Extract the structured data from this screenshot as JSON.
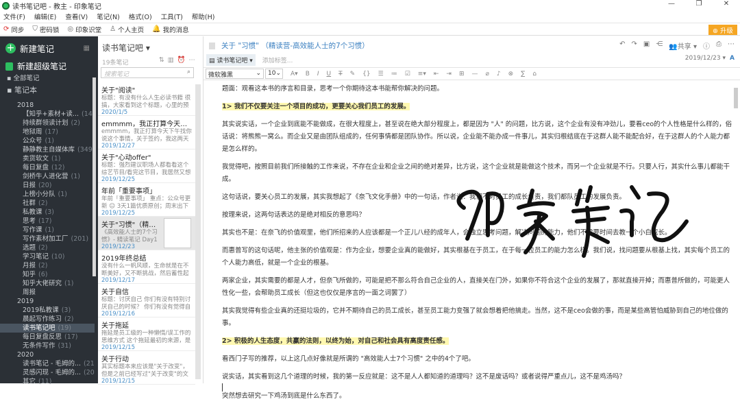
{
  "window": {
    "title": "读书笔记吧 - 教主 - 印象笔记",
    "controls": [
      "—",
      "❐",
      "✕"
    ]
  },
  "menu": [
    "文件(F)",
    "编辑(E)",
    "查看(V)",
    "笔记(N)",
    "格式(O)",
    "工具(T)",
    "帮助(H)"
  ],
  "toolbar": {
    "items": [
      {
        "icon": "sync-icon",
        "glyph": "⟳",
        "label": "同步"
      },
      {
        "icon": "shield-icon",
        "glyph": "⛉",
        "label": "密码锁"
      },
      {
        "icon": "record-icon",
        "glyph": "◎",
        "label": "印象识堂"
      },
      {
        "icon": "user-icon",
        "glyph": "♙",
        "label": "个人主页"
      },
      {
        "icon": "bell-icon",
        "glyph": "🔔",
        "label": "我的消息"
      }
    ],
    "upgrade": "升级"
  },
  "sidebar": {
    "new_note": "新建笔记",
    "new_super_note": "新建超级笔记",
    "all_notes": "全部笔记",
    "notebooks": "笔记本",
    "items": [
      {
        "label": "2018",
        "count": "",
        "level": 0
      },
      {
        "label": "【知乎+素材+读...",
        "count": "(14)",
        "level": 1
      },
      {
        "label": "持续群领读计划",
        "count": "(2)",
        "level": 1
      },
      {
        "label": "地狱周",
        "count": "(17)",
        "level": 1
      },
      {
        "label": "公众号",
        "count": "(1)",
        "level": 1
      },
      {
        "label": "静静教主自媒体库",
        "count": "(349)",
        "level": 1
      },
      {
        "label": "卖货软文",
        "count": "(1)",
        "level": 1
      },
      {
        "label": "每日复盘",
        "count": "(12)",
        "level": 1
      },
      {
        "label": "剑桥牛人进化营",
        "count": "(1)",
        "level": 1
      },
      {
        "label": "日报",
        "count": "(20)",
        "level": 1
      },
      {
        "label": "上榜小分队",
        "count": "(1)",
        "level": 1
      },
      {
        "label": "社群",
        "count": "(2)",
        "level": 1
      },
      {
        "label": "私教课",
        "count": "(3)",
        "level": 1
      },
      {
        "label": "思考",
        "count": "(17)",
        "level": 1
      },
      {
        "label": "写作课",
        "count": "(1)",
        "level": 1
      },
      {
        "label": "写作素材加工厂",
        "count": "(201)",
        "level": 1
      },
      {
        "label": "选题",
        "count": "(2)",
        "level": 1
      },
      {
        "label": "学习笔记",
        "count": "(10)",
        "level": 1
      },
      {
        "label": "月报",
        "count": "(2)",
        "level": 1
      },
      {
        "label": "知乎",
        "count": "(6)",
        "level": 1
      },
      {
        "label": "知乎大佬研究",
        "count": "(1)",
        "level": 1
      },
      {
        "label": "周报",
        "count": "",
        "level": 1
      },
      {
        "label": "2019",
        "count": "",
        "level": 0
      },
      {
        "label": "2019私教课",
        "count": "(3)",
        "level": 1
      },
      {
        "label": "晨起写作练习",
        "count": "(2)",
        "level": 1
      },
      {
        "label": "读书笔记吧",
        "count": "(19)",
        "level": 1,
        "selected": true
      },
      {
        "label": "每日复盘反思",
        "count": "(17)",
        "level": 1
      },
      {
        "label": "无条件写作",
        "count": "(31)",
        "level": 1
      },
      {
        "label": "2020",
        "count": "",
        "level": 0
      },
      {
        "label": "读书笔记 - 毛姆的...",
        "count": "(21)",
        "level": 1
      },
      {
        "label": "灵感闪现 - 毛姆的...",
        "count": "(20)",
        "level": 1
      },
      {
        "label": "其它",
        "count": "(11)",
        "level": 1
      }
    ]
  },
  "notelist": {
    "title": "读书笔记吧 ▾",
    "count": "19条笔记",
    "search_placeholder": "搜索笔记",
    "notes": [
      {
        "title": "关于\"阅读\"",
        "snippet": "标题：有没有什么人生必读书籍 很搞，大家看到这个标题，心里的预期一定...",
        "date": "2020/1/5"
      },
      {
        "title": "emmmm，我正打算今天下午找...",
        "snippet": "emmmm，我正打算今天下午找你说这个事情，关于签约，我这两天自己也...",
        "date": "2019/12/27"
      },
      {
        "title": "关于\"心动offer\"",
        "snippet": "标题：强烈建议职场人都看看这个综艺节目/看完这节目，我居然又想去上班...",
        "date": "2019/12/25"
      },
      {
        "title": "年前「重要事项」",
        "snippet": "年前「重要事项」 重点：公众号更新 ☺ 3天1篇优质原创；周末出下周选...",
        "date": "2019/12/25"
      },
      {
        "title": "关于\"习惯\"（精读营...",
        "snippet": "《高效能人士的7个习惯》- 精读笔记 Day1 ...",
        "date": "2019/12/23",
        "selected": true
      },
      {
        "title": "2019年终总结",
        "snippet": "没有什么一帆风顺，生命就是在不断美好，又不断挑战，然后蓄性起来的慵...",
        "date": "2019/12/17"
      },
      {
        "title": "关于自信",
        "snippet": "标题：讨厌自己 你们有没有特别讨厌自己的时候？ 你们有没有觉得自己特别...",
        "date": "2019/12/16"
      },
      {
        "title": "关于拖延",
        "snippet": "拖延是员工级的一种懒惰/误工作的思维方式 这个拖延最初的来源，是之前在...",
        "date": "2019/12/15"
      },
      {
        "title": "关于行动",
        "snippet": "其实标题本来应该是\"关于改变\"，但是之前已经写过\"关于改变\"的文章了。那...",
        "date": "2019/12/15"
      }
    ]
  },
  "editor": {
    "title": "关于 \"习惯\" （精读营-高效能人士的7个习惯）",
    "notebook": "读书笔记吧 ▾",
    "tag_placeholder": "添加标签...",
    "share": "共享 ▾",
    "date": "2019/12/23 ▾",
    "font": "微软雅黑",
    "size": "10",
    "paragraphs": [
      {
        "text": "题面：观看这本书的序言和目录，思考一个你期待这本书能帮你解决的问题。"
      },
      {
        "text": "1> 我们不仅要关注一个项目的成功，更要关心我们员工的发展。",
        "highlight": true
      },
      {
        "text": "其实说实话，一个企业到底能不能做成，在很大程度上，甚至说在绝大部分程度上，都是因为 \"人\" 的问题，比方说，这个企业有没有冲劲儿，要看ceo的个人性格是什么样的，俗话说：将熊熊一窝么。而企业又是由团队组成的，任何事情都是团队协作。所以说，企业能不能办成一件事儿，其实归根结底在于这群人能不能配合好，在于这群人的个人能力都是怎么样的。"
      },
      {
        "text": "我觉得吧，按照目前我们所接触的工作来说，不存在企业和企业之间的绝对差异，比方说，这个企业就是能做这个技术，而另一个企业就是不行。只要人行，其实什么事儿都能干成。"
      },
      {
        "text": "这句话说，要关心员工的发展，其实我想起了《奈飞文化手册》中的一句话，作者说：我们不对员工的成长负责，我们都队员工的发展负责。"
      },
      {
        "text": "按理来说，这两句话表达的是绝对相反的意思吗？"
      },
      {
        "text": "其实也不是：在奈飞的价值观里，他们所招来的人应该都是一个正儿八经的成年人，会独立思考问题，解决问题的能力，他们不需要时间去教一个小白成长。"
      },
      {
        "text": "而惠普写的这句话呢，他主张的价值观是：作为企业，想要企业真的能做好，其实根基在于员工，在于每一位员工的能力怎么样。我们说，找问题要从根基上找，其实每个员工的个人能力高低，就是一个企业的根基。"
      },
      {
        "text": "两家企业，其实需要的都是人才，但奈飞所做的，可能是把不那么符合自己企业的人，直接关在门外，如果你不符合这个企业的发展了，那就直接开掉；而惠普所做的，可能更人性化一些，会帮助员工成长（但这也仅仅是序言的一面之词罢了）"
      },
      {
        "text": "其实我觉得有些企业真的还挺垃圾的，它并不期待自己的员工成长，甚至员工能力变强了就会想着把他搞走。当然，这不是ceo会做的事，而是某些高管怕威胁到自己的地位做的事。"
      },
      {
        "text": "2> 积极的人生态度，共赢的法则，以终为始，对自己和社会具有高度责任感。",
        "highlight": true
      },
      {
        "text": "看西门子写的推荐，以上这几点好像就是所谓的 \"高效能人士7个习惯\" 之中的4个了吧。"
      },
      {
        "text": "说实话，其实看到这几个道理的时候，我的第一反应就是：这不是人人都知道的道理吗？这不是废话吗？或者说得严重点儿，这不是鸡汤吗？"
      },
      {
        "text": "突然想去研究一下鸡汤到底是什么东西了。",
        "cursor_before": true
      }
    ]
  },
  "watermark": "印象笔记",
  "colors": {
    "accent": "#2dbe60",
    "sidebar": "#2b3036",
    "link": "#3a7fc0",
    "upgrade": "#f5a623",
    "highlight": "#fff8b0"
  }
}
